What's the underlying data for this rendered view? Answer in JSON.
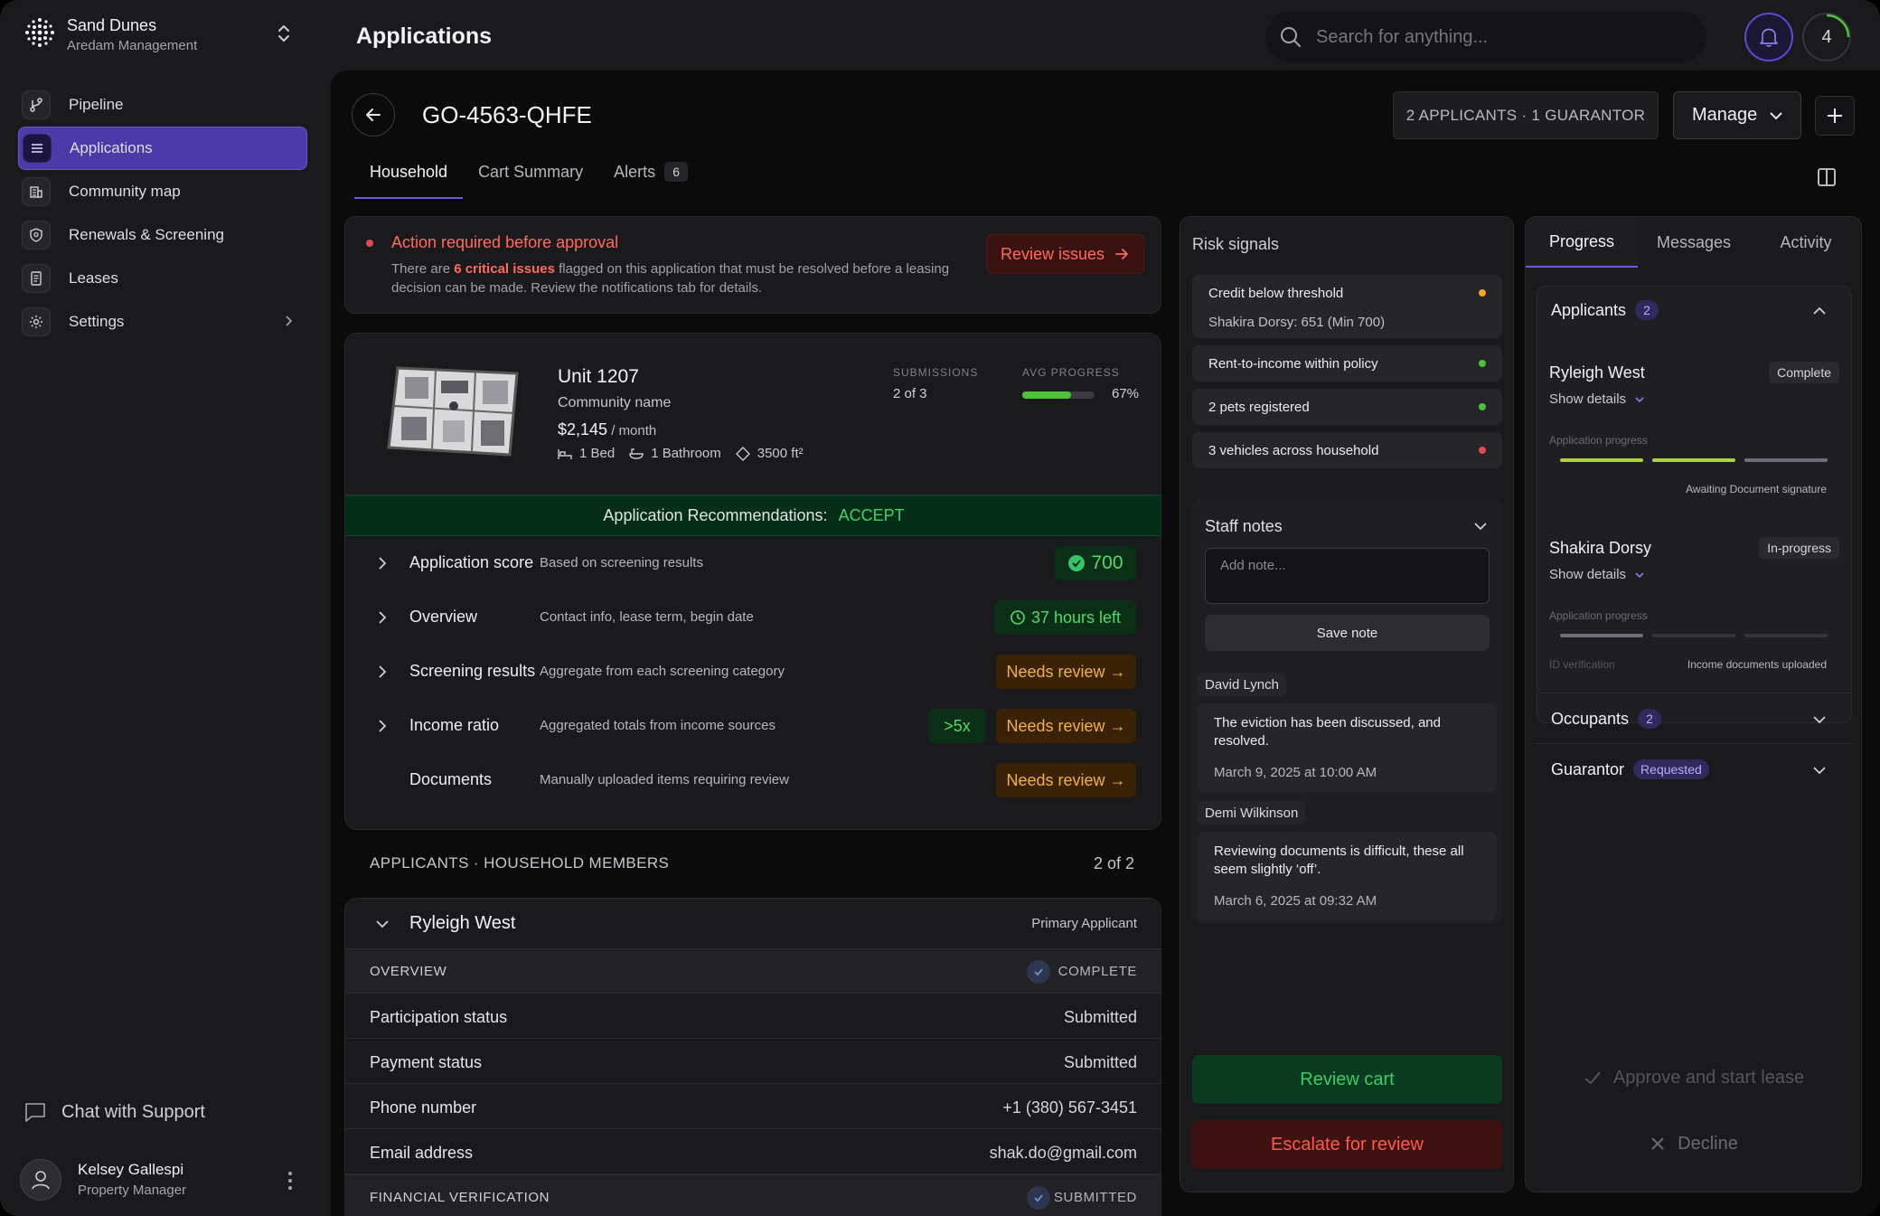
{
  "brand": {
    "name": "Sand Dunes",
    "sub": "Aredam Management"
  },
  "nav": [
    {
      "label": "Pipeline",
      "icon": "pipeline-icon"
    },
    {
      "label": "Applications",
      "icon": "list-icon"
    },
    {
      "label": "Community map",
      "icon": "building-icon"
    },
    {
      "label": "Renewals & Screening",
      "icon": "shield-icon"
    },
    {
      "label": "Leases",
      "icon": "document-icon"
    },
    {
      "label": "Settings",
      "icon": "gear-icon"
    }
  ],
  "support": "Chat with Support",
  "user": {
    "name": "Kelsey Gallespi",
    "role": "Property Manager"
  },
  "header": {
    "title": "Applications",
    "search_placeholder": "Search for anything...",
    "count": "4"
  },
  "application": {
    "id": "GO-4563-QHFE",
    "applicants": "2 APPLICANTS · 1 GUARANTOR",
    "manage": "Manage"
  },
  "tabs": [
    {
      "label": "Household"
    },
    {
      "label": "Cart Summary"
    },
    {
      "label": "Alerts",
      "badge": "6"
    }
  ],
  "alert": {
    "title": "Action required before approval",
    "text_pre": "There are ",
    "text_em": "6 critical issues",
    "text_post": " flagged on this application that must be resolved before a leasing decision can be made. Review the notifications tab for details.",
    "button": "Review issues"
  },
  "unit": {
    "title": "Unit 1207",
    "community": "Community name",
    "price": "$2,145",
    "per": " / month",
    "beds": "1 Bed",
    "baths": "1 Bathroom",
    "area": "3500 ft²",
    "submissions_label": "SUBMISSIONS",
    "submissions": "2 of 3",
    "progress_label": "AVG PROGRESS",
    "progress": "67%",
    "progress_value": 0.67
  },
  "recommendation": {
    "label": "Application Recommendations:",
    "value": "ACCEPT"
  },
  "rows": [
    {
      "title": "Application score",
      "desc": "Based on screening results",
      "pill": "700"
    },
    {
      "title": "Overview",
      "desc": "Contact info, lease term, begin date",
      "pill": "37 hours left"
    },
    {
      "title": "Screening results",
      "desc": "Aggregate from each screening category",
      "pill": "Needs review →"
    },
    {
      "title": "Income ratio",
      "desc": "Aggregated totals from income sources",
      "pill2": ">5x",
      "pill": "Needs review →"
    },
    {
      "title": "Documents",
      "desc": "Manually uploaded items requiring review",
      "pill": "Needs review →"
    }
  ],
  "members": {
    "heading": "APPLICANTS · HOUSEHOLD MEMBERS",
    "count": "2 of 2"
  },
  "applicant": {
    "name": "Ryleigh West",
    "role": "Primary Applicant",
    "overview": "OVERVIEW",
    "overview_status": "COMPLETE",
    "fields": [
      {
        "k": "Participation status",
        "v": "Submitted"
      },
      {
        "k": "Payment status",
        "v": "Submitted"
      },
      {
        "k": "Phone number",
        "v": "+1 (380) 567-3451"
      },
      {
        "k": "Email address",
        "v": "shak.do@gmail.com"
      }
    ],
    "financial": "FINANCIAL VERIFICATION",
    "financial_status": "SUBMITTED"
  },
  "risk": {
    "title": "Risk signals",
    "signals": [
      {
        "title": "Credit below threshold",
        "sub": "Shakira Dorsy: 651 (Min 700)",
        "color": "#f5a623"
      },
      {
        "title": "Rent-to-income within policy",
        "color": "#4ec33a"
      },
      {
        "title": "2 pets registered",
        "color": "#4ec33a"
      },
      {
        "title": "3 vehicles across household",
        "color": "#e5484d"
      }
    ]
  },
  "notes": {
    "title": "Staff notes",
    "placeholder": "Add note...",
    "save": "Save note",
    "items": [
      {
        "author": "David Lynch",
        "text": "The eviction has been discussed, and resolved.",
        "date": "March 9, 2025 at 10:00 AM"
      },
      {
        "author": "Demi Wilkinson",
        "text": "Reviewing documents is difficult, these all seem slightly ‘off’.",
        "date": "March 6, 2025 at 09:32 AM"
      }
    ]
  },
  "actions": {
    "review_cart": "Review cart",
    "escalate": "Escalate for review",
    "approve": "Approve and start lease",
    "decline": "Decline"
  },
  "progress": {
    "tabs": [
      "Progress",
      "Messages",
      "Activity"
    ],
    "applicants_label": "Applicants",
    "applicants_count": "2",
    "people": [
      {
        "name": "Ryleigh West",
        "status": "Complete",
        "show": "Show details",
        "plabel": "Application progress",
        "caption": "Awaiting Document signature"
      },
      {
        "name": "Shakira Dorsy",
        "status": "In-progress",
        "show": "Show details",
        "plabel": "Application progress",
        "caption_left": "ID verification",
        "caption": "Income documents uploaded"
      }
    ],
    "occupants_label": "Occupants",
    "occupants_count": "2",
    "guarantor_label": "Guarantor",
    "guarantor_status": "Requested"
  }
}
